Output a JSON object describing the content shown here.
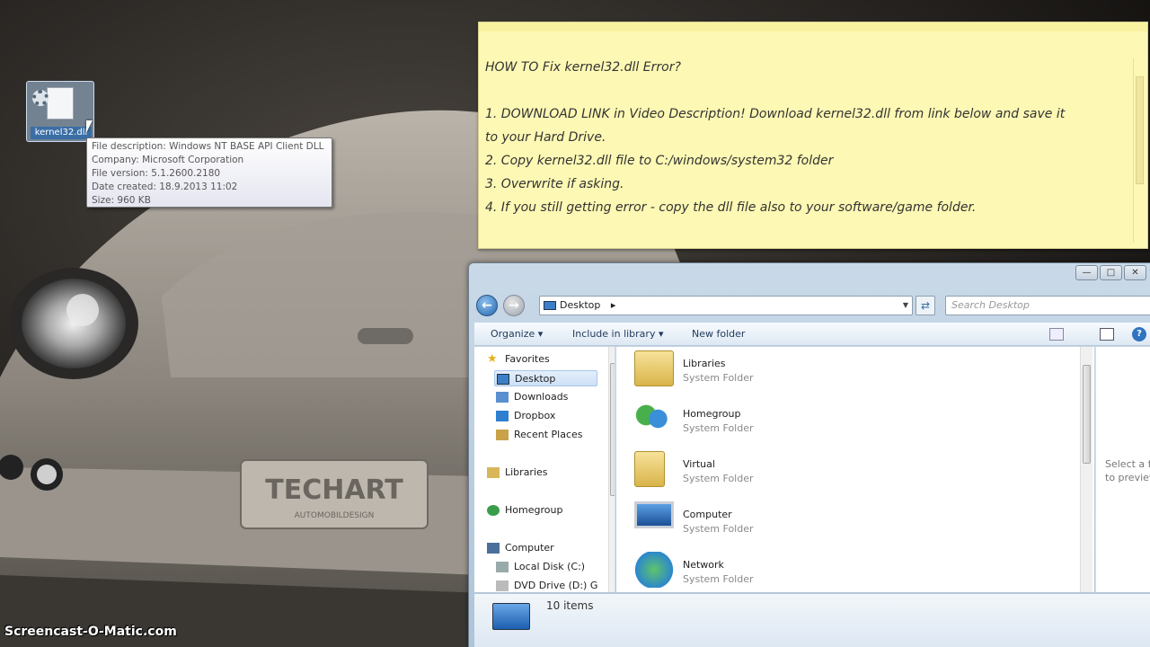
{
  "desktop": {
    "icon_label": "kernel32.dll",
    "wallpaper_badge": "TECHART",
    "wallpaper_badge_sub": "AUTOMOBILDESIGN"
  },
  "tooltip": {
    "line1": "File description: Windows NT BASE API Client DLL",
    "line2": "Company: Microsoft Corporation",
    "line3": "File version: 5.1.2600.2180",
    "line4": "Date created: 18.9.2013 11:02",
    "line5": "Size: 960 KB"
  },
  "sticky_note": {
    "title": "HOW TO Fix kernel32.dll Error?",
    "step1a": "1. DOWNLOAD LINK in Video Description! Download kernel32.dll from link below and save it",
    "step1b": "to your Hard Drive.",
    "step2": "2. Copy kernel32.dll file to C:/windows/system32 folder",
    "step3": "3. Overwrite if asking.",
    "step4": "4. If you still getting error - copy the dll file also to your software/game folder."
  },
  "explorer": {
    "address": "Desktop",
    "search_placeholder": "Search Desktop",
    "toolbar": {
      "organize": "Organize",
      "include_in_library": "Include in library",
      "new_folder": "New folder"
    },
    "nav": {
      "favorites": "Favorites",
      "desktop": "Desktop",
      "downloads": "Downloads",
      "dropbox": "Dropbox",
      "recent_places": "Recent Places",
      "libraries": "Libraries",
      "homegroup": "Homegroup",
      "computer": "Computer",
      "local_disk": "Local Disk (C:)",
      "dvd_drive": "DVD Drive (D:) G"
    },
    "items": [
      {
        "name": "Libraries",
        "type": "System Folder"
      },
      {
        "name": "Homegroup",
        "type": "System Folder"
      },
      {
        "name": "Virtual",
        "type": "System Folder"
      },
      {
        "name": "Computer",
        "type": "System Folder"
      },
      {
        "name": "Network",
        "type": "System Folder"
      }
    ],
    "preview_text1": "Select a fil",
    "preview_text2": "to preview",
    "status": "10 items"
  },
  "watermark": "Screencast-O-Matic.com"
}
